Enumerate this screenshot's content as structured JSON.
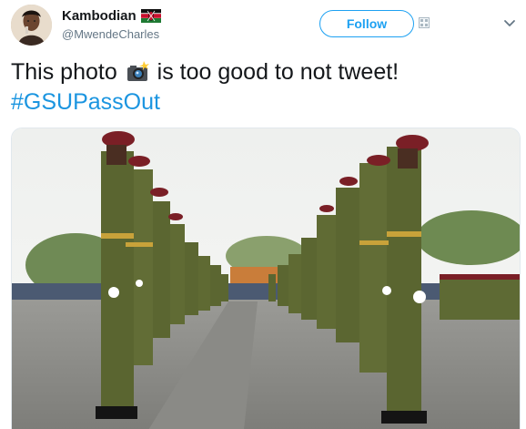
{
  "author": {
    "display_name": "Kambodian",
    "handle": "@MwendeCharles",
    "flag": "kenya-flag-emoji",
    "avatar": "profile-avatar"
  },
  "actions": {
    "follow_label": "Follow"
  },
  "tweet": {
    "text_before": "This photo",
    "emoji": "camera-with-flash-emoji",
    "text_after": "is too good to not tweet!",
    "hashtag": "#GSUPassOut"
  },
  "media": {
    "description": "photo",
    "icon": "tweet-photo"
  },
  "colors": {
    "accent": "#1da1f2",
    "hashtag": "#1b95e0",
    "text": "#14171a",
    "muted": "#657786"
  }
}
